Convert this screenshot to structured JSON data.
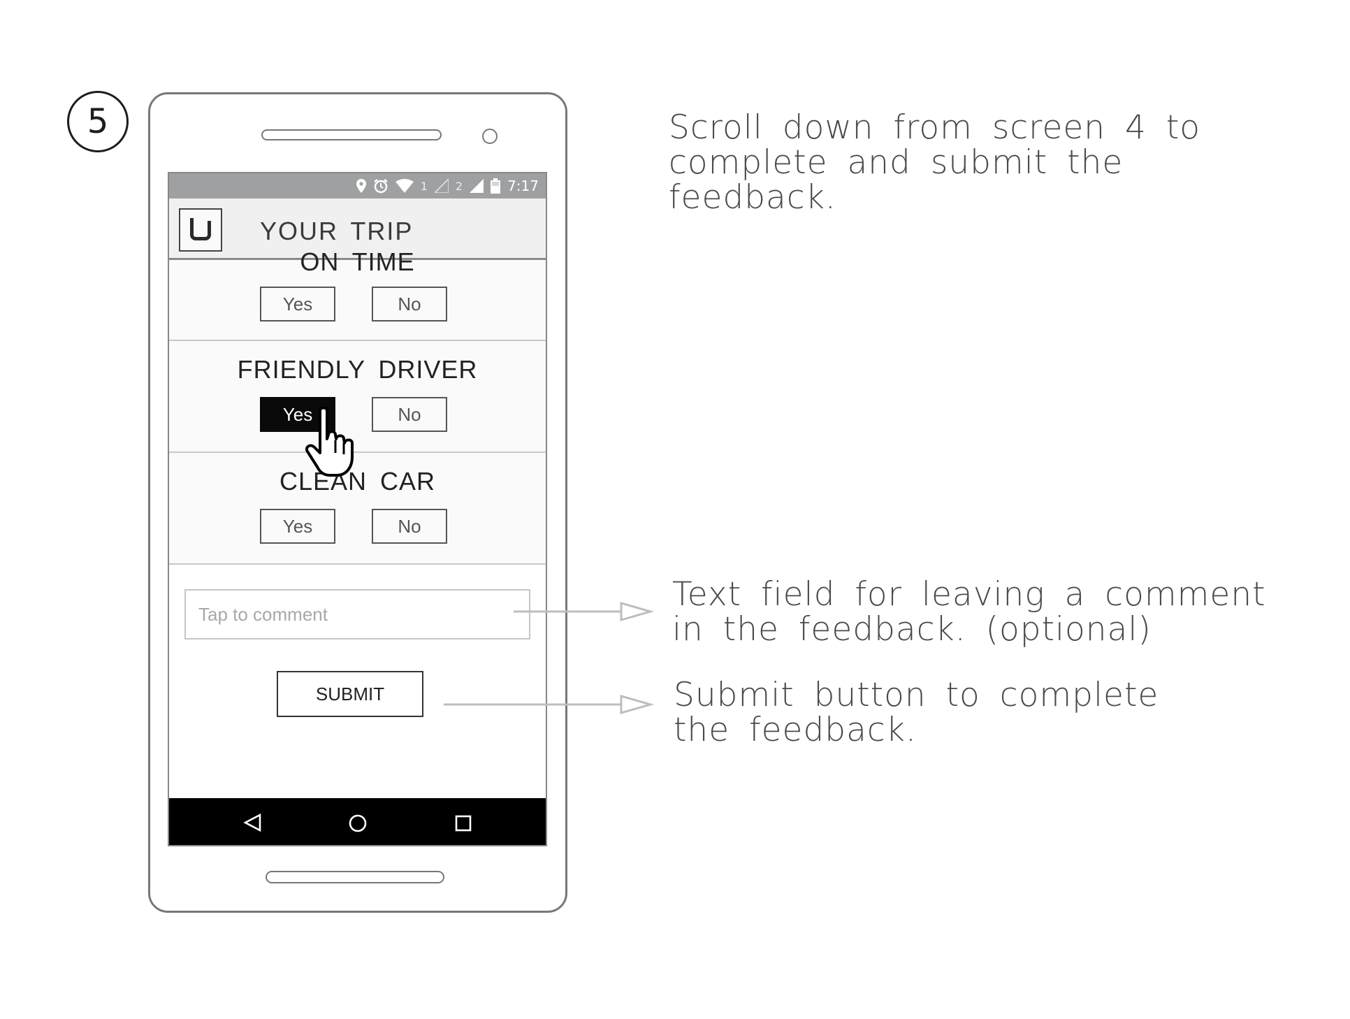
{
  "step_number": "5",
  "phone": {
    "status_bar": {
      "icons": [
        "location-pin-icon",
        "alarm-icon",
        "wifi-icon",
        "signal-sim1-icon",
        "signal-sim2-icon",
        "battery-icon"
      ],
      "sim1_label": "1",
      "sim2_label": "2",
      "time": "7:17"
    },
    "header": {
      "logo": "uber-logo-icon",
      "title": "YOUR TRIP"
    },
    "sections": [
      {
        "title": "ON TIME",
        "yes_label": "Yes",
        "no_label": "No",
        "selected": ""
      },
      {
        "title": "FRIENDLY DRIVER",
        "yes_label": "Yes",
        "no_label": "No",
        "selected": "Yes"
      },
      {
        "title": "CLEAN CAR",
        "yes_label": "Yes",
        "no_label": "No",
        "selected": ""
      }
    ],
    "comment_placeholder": "Tap to comment",
    "submit_label": "SUBMIT",
    "nav_icons": [
      "back-icon",
      "home-icon",
      "recents-icon"
    ]
  },
  "annotations": {
    "top": "Scroll down from screen 4 to complete and submit the feedback.",
    "comment": "Text field for leaving a comment in the feedback. (optional)",
    "submit": "Submit button to complete the feedback."
  },
  "colors": {
    "status_bar": "#9fa0a2",
    "header_bg": "#f0f0f1",
    "selected_button": "#0a0a0a",
    "nav_bar": "#000000",
    "annotation_text": "#4a4a4a",
    "arrow": "#bdbdbd"
  }
}
